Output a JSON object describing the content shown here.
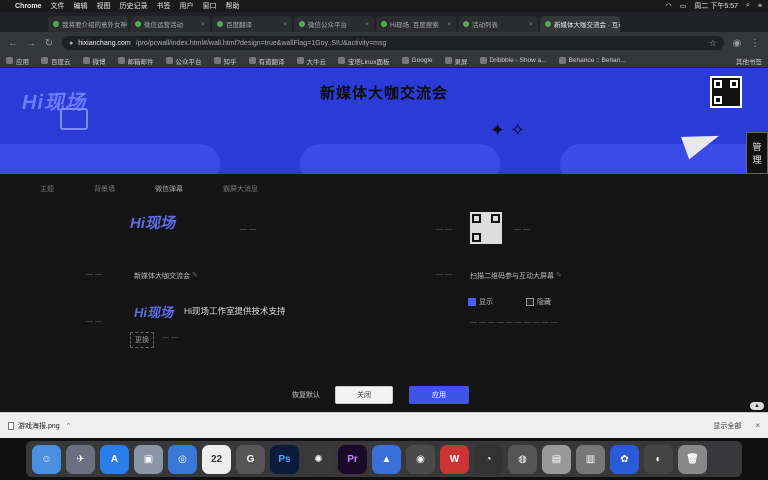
{
  "menubar": {
    "apple": "",
    "app": "Chrome",
    "items": [
      "文件",
      "编辑",
      "视图",
      "历史记录",
      "书签",
      "用户",
      "窗口",
      "帮助"
    ],
    "clock": "周二 下午5:57"
  },
  "tabs": [
    {
      "label": "我将要介绍的意外女神"
    },
    {
      "label": "微信运营活动"
    },
    {
      "label": "百度翻译"
    },
    {
      "label": "微信公众平台"
    },
    {
      "label": "Hi现场, 百度搜索"
    },
    {
      "label": "活动列表"
    },
    {
      "label": "新媒体大咖交流会 · 互动"
    }
  ],
  "address": {
    "host": "hixianchang.com",
    "path": "/pro/pcwall/index.html#/wall.html?design=true&wallFlag=1Goy..SIU&activity=msg"
  },
  "bookmarks": {
    "items": [
      "应用",
      "百度云",
      "微博",
      "邮箱邮件",
      "公众平台",
      "知乎",
      "有道翻译",
      "大牛云",
      "宝塔Linux面板",
      "Google",
      "录屏",
      "Dribbble - Show a...",
      "Behance :: Behan..."
    ],
    "other": "其他书签"
  },
  "banner": {
    "logo": "Hi现场",
    "title": "新媒体大咖交流会",
    "side_btn_top": "管",
    "side_btn_bottom": "理"
  },
  "nav_tabs": [
    "主题",
    "背景墙",
    "微信弹幕",
    "霸屏大消息"
  ],
  "settings": {
    "brand": "Hi现场",
    "left_label": "新媒体大咖交流会",
    "support_text": "Hi现场工作室提供技术支持",
    "right_label": "扫描二维码参与互动大屏幕",
    "opt_show": "显示",
    "opt_hide": "隐藏",
    "small_btn": "更换"
  },
  "footer": {
    "restore": "恢复默认",
    "close": "关闭",
    "apply": "应用"
  },
  "downloads": {
    "file": "游戏海报.png",
    "show_all": "显示全部"
  },
  "dock": [
    "Finder",
    "Launchpad",
    "App Store",
    "Preview",
    "Safari",
    "Calendar",
    "Keyboard",
    "Photoshop",
    "Bug",
    "Premiere",
    "Keynote",
    "Chrome",
    "WPS",
    "QQ",
    "WeChat",
    "Notes",
    "Books",
    "Baidu",
    "QuickTime",
    "Trash"
  ],
  "colors": {
    "banner": "#2a3bd8",
    "primary": "#3f54e6"
  }
}
